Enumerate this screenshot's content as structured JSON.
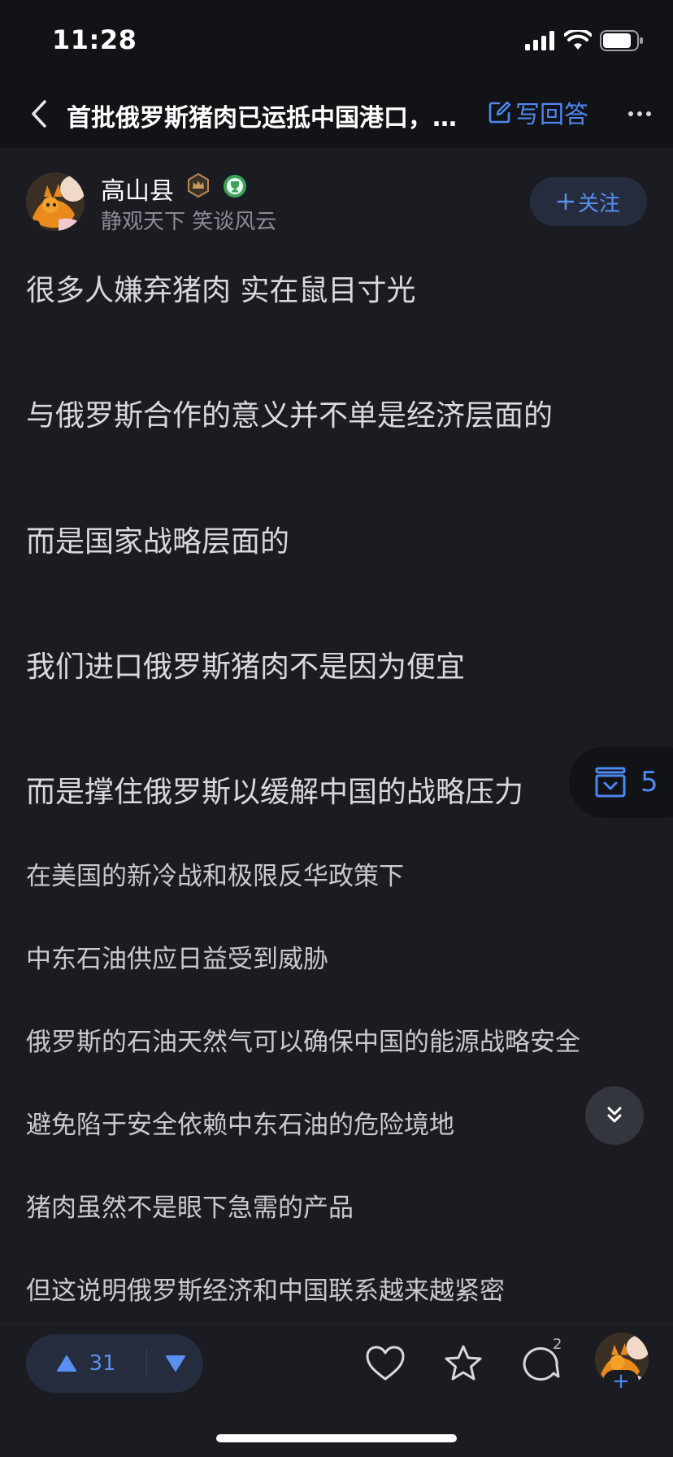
{
  "status_bar": {
    "time": "11:28"
  },
  "nav": {
    "title": "首批俄罗斯猪肉已运抵中国港口，…",
    "write_answer": "写回答"
  },
  "author": {
    "name": "高山县",
    "bio": "静观天下 笑谈风云",
    "follow": "关注"
  },
  "content": {
    "large_paragraphs": [
      "很多人嫌弃猪肉 实在鼠目寸光",
      "与俄罗斯合作的意义并不单是经济层面的",
      "而是国家战略层面的",
      "我们进口俄罗斯猪肉不是因为便宜",
      "而是撑住俄罗斯以缓解中国的战略压力"
    ],
    "small_paragraphs": [
      "在美国的新冷战和极限反华政策下",
      "中东石油供应日益受到威胁",
      "俄罗斯的石油天然气可以确保中国的能源战略安全",
      "避免陷于安全依赖中东石油的危险境地",
      "猪肉虽然不是眼下急需的产品",
      "但这说明俄罗斯经济和中国联系越来越紧密"
    ]
  },
  "floating": {
    "collection_count": "5"
  },
  "bottom_bar": {
    "upvote_count": "31",
    "comment_count": "2",
    "add_symbol": "+"
  },
  "colors": {
    "background": "#1b1c21",
    "bar": "#121317",
    "accent": "#4e87f0",
    "text": "#d8d9de"
  },
  "icons": [
    "back-icon",
    "edit-icon",
    "more-icon",
    "crown-badge-icon",
    "trophy-badge-icon",
    "plus-icon",
    "collection-box-icon",
    "double-chevron-down-icon",
    "upvote-icon",
    "downvote-icon",
    "heart-icon",
    "star-icon",
    "comment-icon"
  ]
}
